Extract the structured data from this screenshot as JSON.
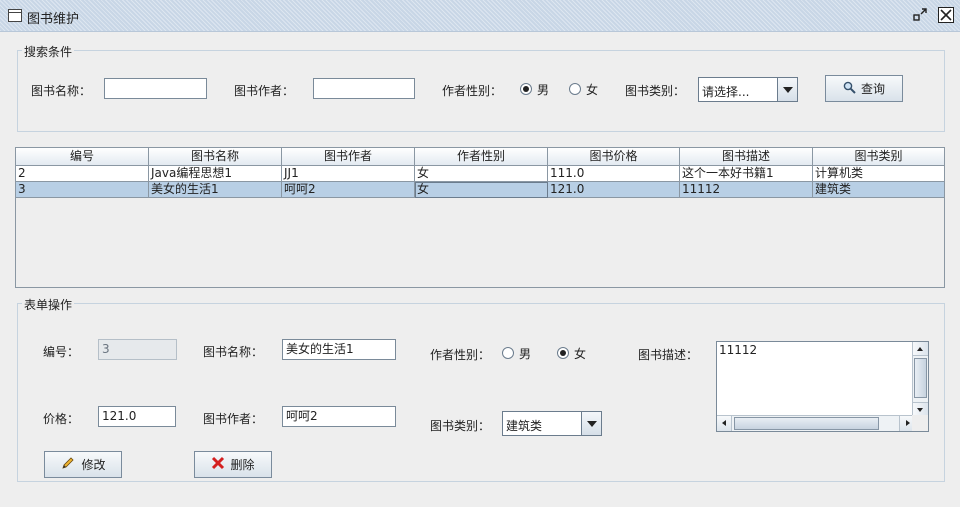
{
  "window": {
    "title": "图书维护"
  },
  "search": {
    "legend": "搜索条件",
    "name_label": "图书名称：",
    "name_value": "",
    "author_label": "图书作者：",
    "author_value": "",
    "gender_label": "作者性别：",
    "male": "男",
    "female": "女",
    "selected_gender": "男",
    "type_label": "图书类别：",
    "type_value": "请选择...",
    "query_button": "查询"
  },
  "table": {
    "columns": [
      "编号",
      "图书名称",
      "图书作者",
      "作者性别",
      "图书价格",
      "图书描述",
      "图书类别"
    ],
    "rows": [
      [
        "2",
        "Java编程思想1",
        "JJ1",
        "女",
        "111.0",
        "这个一本好书籍1",
        "计算机类"
      ],
      [
        "3",
        "美女的生活1",
        "呵呵2",
        "女",
        "121.0",
        "11112",
        "建筑类"
      ]
    ],
    "selected_row": 1
  },
  "form": {
    "legend": "表单操作",
    "id_label": "编号：",
    "id_value": "3",
    "name_label": "图书名称：",
    "name_value": "美女的生活1",
    "gender_label": "作者性别：",
    "male": "男",
    "female": "女",
    "selected_gender": "女",
    "desc_label": "图书描述：",
    "desc_value": "11112",
    "price_label": "价格：",
    "price_value": "121.0",
    "author_label": "图书作者：",
    "author_value": "呵呵2",
    "type_label": "图书类别：",
    "type_value": "建筑类",
    "edit_button": "修改",
    "delete_button": "删除"
  },
  "icons": {
    "window": "window-icon",
    "search": "magnifier-icon",
    "edit": "pencil-icon",
    "delete": "red-x-icon"
  },
  "colors": {
    "selection": "#b8cfe5",
    "delete_icon": "#d42020",
    "edit_icon": "#e0a020"
  }
}
